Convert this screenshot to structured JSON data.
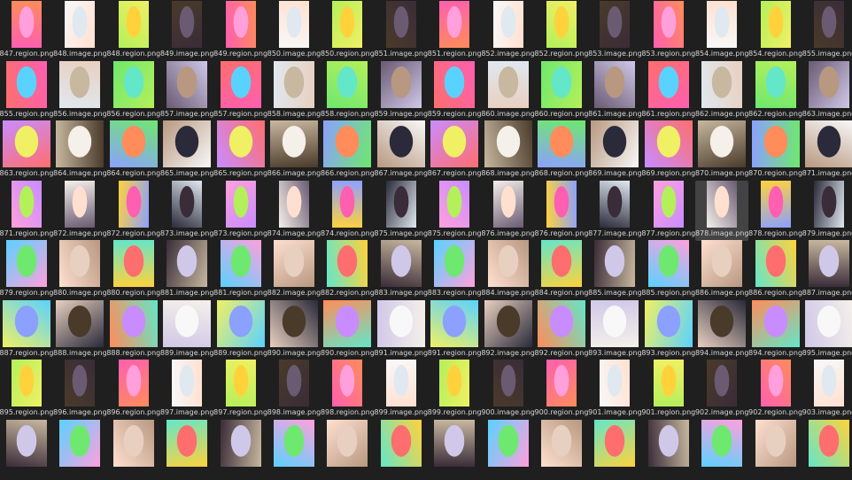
{
  "thumbnail_icon": "image-thumbnail-icon",
  "selected_file": "878.image.png",
  "rows": [
    [
      "847.region.png",
      "848.image.png",
      "848.region.png",
      "849.image.png",
      "849.region.png",
      "850.image.png",
      "850.region.png",
      "851.image.png",
      "851.region.png",
      "852.image.png",
      "852.region.png",
      "853.image.png",
      "853.region.png",
      "854.image.png",
      "854.region.png",
      "855.image.png"
    ],
    [
      "855.region.png",
      "856.image.png",
      "856.region.png",
      "857.image.png",
      "857.region.png",
      "858.image.png",
      "858.region.png",
      "859.image.png",
      "859.region.png",
      "860.image.png",
      "860.region.png",
      "861.image.png",
      "861.region.png",
      "862.image.png",
      "862.region.png",
      "863.image.png"
    ],
    [
      "863.region.png",
      "864.image.png",
      "864.region.png",
      "865.image.png",
      "865.region.png",
      "866.image.png",
      "866.region.png",
      "867.image.png",
      "867.region.png",
      "868.image.png",
      "868.region.png",
      "869.image.png",
      "869.region.png",
      "870.image.png",
      "870.region.png",
      "871.image.png"
    ],
    [
      "871.region.png",
      "872.image.png",
      "872.region.png",
      "873.image.png",
      "873.region.png",
      "874.image.png",
      "874.region.png",
      "875.image.png",
      "875.region.png",
      "876.image.png",
      "876.region.png",
      "877.image.png",
      "877.region.png",
      "878.image.png",
      "878.region.png",
      "879.image.png"
    ],
    [
      "879.region.png",
      "880.image.png",
      "880.region.png",
      "881.image.png",
      "881.region.png",
      "882.image.png",
      "882.region.png",
      "883.image.png",
      "883.region.png",
      "884.image.png",
      "884.region.png",
      "885.image.png",
      "885.region.png",
      "886.image.png",
      "886.region.png",
      "887.image.png"
    ],
    [
      "887.region.png",
      "888.image.png",
      "888.region.png",
      "889.image.png",
      "889.region.png",
      "890.image.png",
      "890.region.png",
      "891.image.png",
      "891.region.png",
      "892.image.png",
      "892.region.png",
      "893.image.png",
      "893.region.png",
      "894.image.png",
      "894.region.png",
      "895.image.png"
    ],
    [
      "895.region.png",
      "896.image.png",
      "896.region.png",
      "897.image.png",
      "897.region.png",
      "898.image.png",
      "898.region.png",
      "899.image.png",
      "899.region.png",
      "900.image.png",
      "900.region.png",
      "901.image.png",
      "901.region.png",
      "902.image.png",
      "902.region.png",
      "903.image.png"
    ],
    [
      "",
      "",
      "",
      "",
      "",
      "",
      "",
      "",
      "",
      "",
      "",
      "",
      "",
      "",
      "",
      ""
    ]
  ],
  "palette": {
    "region": [
      "#ff5fb0",
      "#6ee86e",
      "#c88cff",
      "#ffd23c",
      "#5ad2ff",
      "#ff8c5a",
      "#b4f05a",
      "#ff6e6e",
      "#8ca0ff",
      "#ffa0dc",
      "#64e6c8",
      "#f0f064"
    ],
    "image": [
      "#f5f0ea",
      "#3a2c38",
      "#e8d0c0",
      "#f8f8f8",
      "#6a5a72",
      "#c8b8a0",
      "#2a2a3a",
      "#ffe0d0",
      "#d0c8e8",
      "#4a3a2a",
      "#e0e8f0",
      "#b89880"
    ]
  }
}
